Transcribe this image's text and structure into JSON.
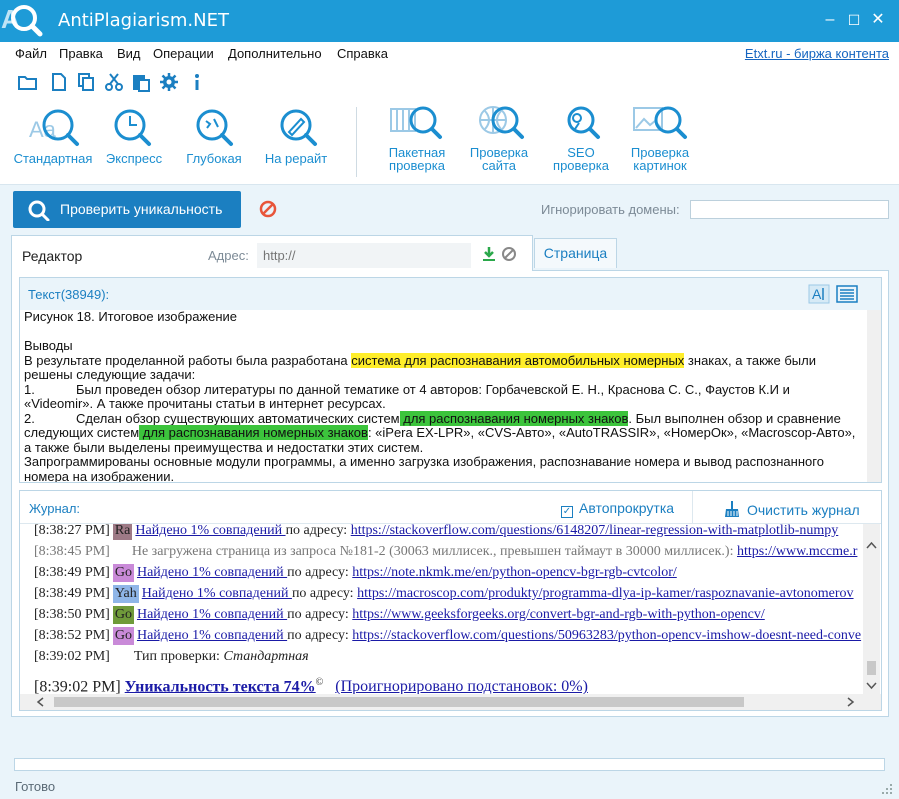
{
  "window": {
    "title": "AntiPlagiarism.NET",
    "minimize": "–",
    "maximize": "☐",
    "close": "✕"
  },
  "menu": {
    "items": [
      "Файл",
      "Правка",
      "Вид",
      "Операции",
      "Дополнительно",
      "Справка"
    ],
    "etxt_link": "Etxt.ru - биржа контента"
  },
  "toolbar": {
    "icons": [
      "folder-open-icon",
      "new-file-icon",
      "copy-icon",
      "cut-icon",
      "paste-icon",
      "settings-icon",
      "info-icon"
    ]
  },
  "ribbon": {
    "check_types": [
      {
        "line1": "Стандартная",
        "line2": ""
      },
      {
        "line1": "Экспресс",
        "line2": ""
      },
      {
        "line1": "Глубокая",
        "line2": ""
      },
      {
        "line1": "На рерайт",
        "line2": ""
      }
    ],
    "tools": [
      {
        "line1": "Пакетная",
        "line2": "проверка"
      },
      {
        "line1": "Проверка",
        "line2": "сайта"
      },
      {
        "line1": "SEO",
        "line2": "проверка"
      },
      {
        "line1": "Проверка",
        "line2": "картинок"
      }
    ]
  },
  "actions": {
    "check_button": "Проверить уникальность",
    "ignore_domains_label": "Игнорировать домены:",
    "ignore_domains_value": ""
  },
  "editor": {
    "tab_label": "Редактор",
    "address_label": "Адрес:",
    "address_placeholder": "http://",
    "page_tab": "Страница"
  },
  "text": {
    "header": "Текст(38949):",
    "caption": "Рисунок 18. Итоговое изображение",
    "conclusions_title": "Выводы",
    "p1_before": "В результате проделанной работы была разработана ",
    "p1_highlight": "система для распознавания автомобильных номерных",
    "p1_after": " знаках, а также были",
    "p1_line2": "решены следующие задачи:",
    "item1_num": "1.",
    "item1_line1": "Был проведен обзор литературы по данной тематике от 4 авторов: Горбачевской Е. Н., Краснова С. С., Фаустов К.И и",
    "item1_line2": "«Videomir». А также прочитаны статьи в интернет ресурсах.",
    "item2_num": "2.",
    "item2_before": "Сделан обзор существующих автоматических систем",
    "item2_highlight1": " для распознавания номерных знаков",
    "item2_after1": ". Был выполнен обзор и сравнение",
    "item2_line2_before": "следующих систем",
    "item2_highlight2": " для распознавания номерных знаков",
    "item2_line2_after": ": «iPera EX-LPR», «CVS-Авто», «AutoTRASSIR», «НомерОк», «Macroscop-Авто»,",
    "item2_line3": "а также были выделены преимущества и недостатки этих систем.",
    "p3_line1": "Запрограммированы основные модули программы, а именно загрузка изображения, распознавание номера и вывод распознанного",
    "p3_line2": "номера на изображении."
  },
  "journal": {
    "header": "Журнал:",
    "autoscroll": "Автопрокрутка",
    "autoscroll_checked": "✓",
    "clear": "Очистить журнал",
    "entries": [
      {
        "ts": "[8:38:27 PM]",
        "badge": "Ra",
        "badge_color": "#9e7a86",
        "link": "Найдено 1% совпадений ",
        "by": "по адресу: ",
        "url": "https://stackoverflow.com/questions/6148207/linear-regression-with-matplotlib-numpy"
      },
      {
        "ts": "[8:38:45 PM]",
        "msg": "Не загружена страница из запроса №181-2 (30063 миллисек., превышен таймаут в 30000 миллисек.): ",
        "url": "https://www.mccme.r"
      },
      {
        "ts": "[8:38:49 PM]",
        "badge": "Go",
        "badge_color": "#c98ad8",
        "link": "Найдено 1% совпадений ",
        "by": "по адресу: ",
        "url": "https://note.nkmk.me/en/python-opencv-bgr-rgb-cvtcolor/"
      },
      {
        "ts": "[8:38:49 PM]",
        "badge": "Yah",
        "badge_color": "#8fb6e8",
        "link": "Найдено 1% совпадений ",
        "by": "по адресу: ",
        "url": "https://macroscop.com/produkty/programma-dlya-ip-kamer/raspoznavanie-avtonomerov"
      },
      {
        "ts": "[8:38:50 PM]",
        "badge": "Go",
        "badge_color": "#6f9a3a",
        "link": "Найдено 1% совпадений ",
        "by": "по адресу: ",
        "url": "https://www.geeksforgeeks.org/convert-bgr-and-rgb-with-python-opencv/"
      },
      {
        "ts": "[8:38:52 PM]",
        "badge": "Go",
        "badge_color": "#c98ad8",
        "link": "Найдено 1% совпадений ",
        "by": "по адресу: ",
        "url": "https://stackoverflow.com/questions/50963283/python-opencv-imshow-doesnt-need-conve"
      },
      {
        "ts": "[8:39:02 PM]",
        "check_type_label": "Тип проверки: ",
        "check_type": "Стандартная"
      }
    ],
    "final": {
      "ts": "[8:39:02 PM]",
      "uniqueness": "Уникальность текста 74%",
      "copyright": "©",
      "ignored": "(Проигнорировано подстановок: 0%)"
    }
  },
  "status": {
    "text": "Готово"
  },
  "colors": {
    "accent": "#1e9bd7",
    "button": "#1b7fc1",
    "highlight_yellow": "#ffee2a",
    "highlight_green": "#3cc43c"
  }
}
